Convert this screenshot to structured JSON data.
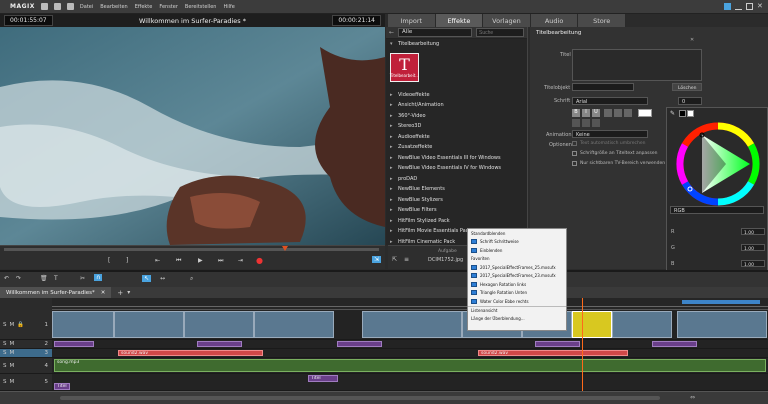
{
  "menubar": {
    "logo": "MAGIX",
    "items": [
      "Datei",
      "Bearbeiten",
      "Effekte",
      "Fenster",
      "Bereitstellen",
      "Hilfe"
    ]
  },
  "preview": {
    "timecode_left": "00:01:55:07",
    "title": "Willkommen im Surfer-Paradies *",
    "timecode_right": "00:00:21:14"
  },
  "tabs": [
    {
      "label": "Import",
      "active": false
    },
    {
      "label": "Effekte",
      "active": true
    },
    {
      "label": "Vorlagen",
      "active": false
    },
    {
      "label": "Audio",
      "active": false
    },
    {
      "label": "Store",
      "active": false
    }
  ],
  "effects": {
    "filter": "Alle",
    "search_placeholder": "Suche",
    "header": "Titelbearbeitung",
    "thumb_letter": "T",
    "thumb_label": "Titelbearbeit...",
    "categories": [
      "Videoeffekte",
      "Ansicht/Animation",
      "360°-Video",
      "Stereo3D",
      "Audioeffekte",
      "Zusatzeffekte",
      "NewBlue Video Essentials III for Windows",
      "NewBlue Video Essentials IV for Windows",
      "proDAD",
      "NewBlue Elements",
      "NewBlue Stylizers",
      "NewBlue Filters",
      "HitFilm Stylized Pack",
      "HitFilm Movie Essentials Pack",
      "HitFilm Cinematic Pack"
    ],
    "bottom_file": "DCIM1752.jpg",
    "bottom_label": "Aufgabe"
  },
  "props": {
    "title": "Titelbearbeitung",
    "titel_label": "Titel",
    "titelobjekt_label": "Titelobjekt",
    "loeschen_label": "Löschen",
    "schrift_label": "Schrift",
    "font_value": "Arial",
    "size_value": "0",
    "animation_label": "Animation",
    "animation_value": "Keine",
    "optionen_label": "Optionen",
    "opt1": "Text automatisch umbrechen",
    "opt2": "Schriftgröße an Titeltext anpassen",
    "opt3": "Nur sichtbaren TV-Bereich verwenden"
  },
  "picker": {
    "mode": "RGB",
    "r_label": "R",
    "g_label": "G",
    "b_label": "B",
    "r_value": "1.00",
    "g_value": "1.00",
    "b_value": "1.00"
  },
  "dropdown": {
    "items": [
      "Standardblenden",
      "Schrift Schrittweise",
      "Einblenden",
      "Favoriten",
      "2017_SpecialEffectFrames_25.mxsufx",
      "2017_SpecialEffectFrames_23.mxsufx",
      "Hexagon Rotation links",
      "Triangle Rotation Unten",
      "Water Color Ebbe rechts",
      "Listenansicht",
      "Länge der Überblendung..."
    ]
  },
  "timeline": {
    "tab": "Willkommen im Surfer-Paradies*",
    "tracks": [
      "1",
      "2",
      "3",
      "4",
      "5"
    ],
    "audio_clip_1": "sound2.wav",
    "audio_clip_2": "sound2.wav",
    "music_clip": "song.mp3",
    "title_clip": "Titel",
    "title_clip_2": "Titel"
  }
}
